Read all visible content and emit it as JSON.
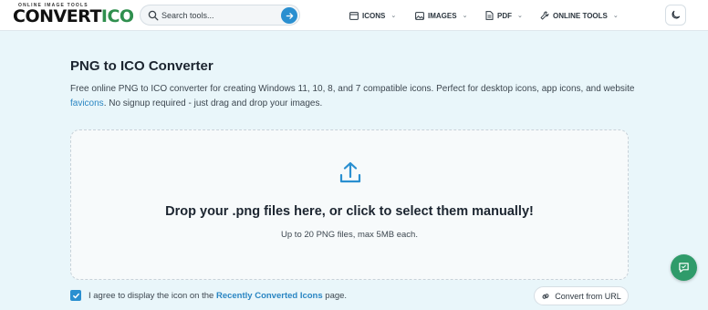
{
  "header": {
    "logo_tagline": "ONLINE IMAGE TOOLS",
    "logo_part1": "CONVERT",
    "logo_part2": "ICO",
    "search_placeholder": "Search tools...",
    "nav": [
      {
        "label": "ICONS",
        "icon": "icons-icon"
      },
      {
        "label": "IMAGES",
        "icon": "image-icon"
      },
      {
        "label": "PDF",
        "icon": "document-icon"
      },
      {
        "label": "ONLINE TOOLS",
        "icon": "wrench-icon"
      }
    ],
    "theme_icon": "moon-icon"
  },
  "main": {
    "title": "PNG to ICO Converter",
    "desc_part1": "Free online PNG to ICO converter for creating Windows 11, 10, 8, and 7 compatible icons. Perfect for desktop icons, app icons, and website ",
    "desc_link": "favicons",
    "desc_part2": ". No signup required - just drag and drop your images.",
    "dropzone": {
      "title": "Drop your .png files here, or click to select them manually!",
      "subtitle": "Up to 20 PNG files, max 5MB each.",
      "icon": "upload-icon"
    },
    "agree": {
      "checked": true,
      "text_before": "I agree to display the icon on the ",
      "link": "Recently Converted Icons",
      "text_after": " page."
    },
    "url_button": "Convert from URL"
  },
  "colors": {
    "accent": "#2a8fd0",
    "background": "#e9f6fa",
    "feedback": "#2f9b6a",
    "logo_green": "#2f8f4e"
  }
}
